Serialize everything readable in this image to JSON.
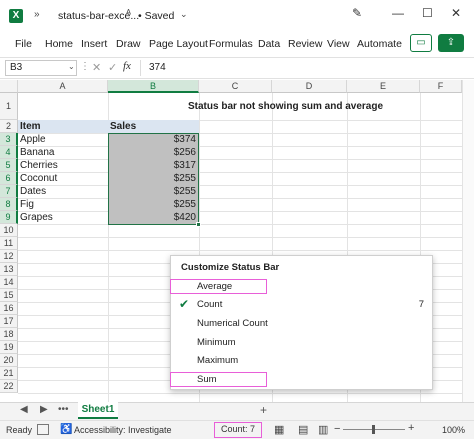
{
  "titlebar": {
    "app_icon": "X",
    "more_glyph": "»",
    "filename": "status-bar-exce...",
    "saved_label": "• Saved",
    "chevron": "⌄",
    "autosave_icon": "autosave-icon",
    "window_controls": {
      "pen": "✎",
      "minimize": "—",
      "maximize": "☐",
      "close": "✕"
    }
  },
  "ribbon": {
    "tabs": [
      "File",
      "Home",
      "Insert",
      "Draw",
      "Page Layout",
      "Formulas",
      "Data",
      "Review",
      "View",
      "Automate"
    ],
    "comment_glyph": "💬",
    "share_glyph": "⇪"
  },
  "formula_bar": {
    "name_box": "B3",
    "fx": "fx",
    "value": "374",
    "cancel_glyph": "✕",
    "enter_glyph": "✓",
    "dots": "⋮"
  },
  "grid": {
    "columns": [
      "A",
      "B",
      "C",
      "D",
      "E",
      "F"
    ],
    "rows": [
      "1",
      "2",
      "3",
      "4",
      "5",
      "6",
      "7",
      "8",
      "9",
      "10",
      "11",
      "12",
      "13",
      "14",
      "15",
      "16",
      "17",
      "18",
      "19",
      "20",
      "21",
      "22"
    ],
    "title": "Status bar not showing sum and average",
    "header": {
      "item": "Item",
      "sales": "Sales"
    },
    "data": [
      {
        "item": "Apple",
        "sales": "$374"
      },
      {
        "item": "Banana",
        "sales": "$256"
      },
      {
        "item": "Cherries",
        "sales": "$317"
      },
      {
        "item": "Coconut",
        "sales": "$255"
      },
      {
        "item": "Dates",
        "sales": "$255"
      },
      {
        "item": "Fig",
        "sales": "$255"
      },
      {
        "item": "Grapes",
        "sales": "$420"
      }
    ]
  },
  "menu": {
    "title": "Customize Status Bar",
    "items": [
      {
        "label": "Average",
        "value": "",
        "checked": false
      },
      {
        "label": "Count",
        "value": "7",
        "checked": true
      },
      {
        "label": "Numerical Count",
        "value": "",
        "checked": false
      },
      {
        "label": "Minimum",
        "value": "",
        "checked": false
      },
      {
        "label": "Maximum",
        "value": "",
        "checked": false
      },
      {
        "label": "Sum",
        "value": "",
        "checked": false
      }
    ],
    "check_glyph": "✔"
  },
  "sheets": {
    "nav_prev": "◀",
    "nav_next": "▶",
    "nav_more": "•••",
    "active": "Sheet1",
    "add": "+"
  },
  "status": {
    "ready": "Ready",
    "macro_glyph": "▣",
    "accessibility_glyph": "♿",
    "accessibility": "Accessibility: Investigate",
    "count": "Count: 7",
    "view_normal": "▦",
    "view_layout": "▤",
    "view_break": "▥",
    "zoom_minus": "−",
    "zoom_plus": "+",
    "zoom": "100%"
  },
  "colors": {
    "brand": "#107c41",
    "highlight": "#e85fd8",
    "selection_fill": "#c0c0c0",
    "header_band": "#dbe5f1"
  }
}
